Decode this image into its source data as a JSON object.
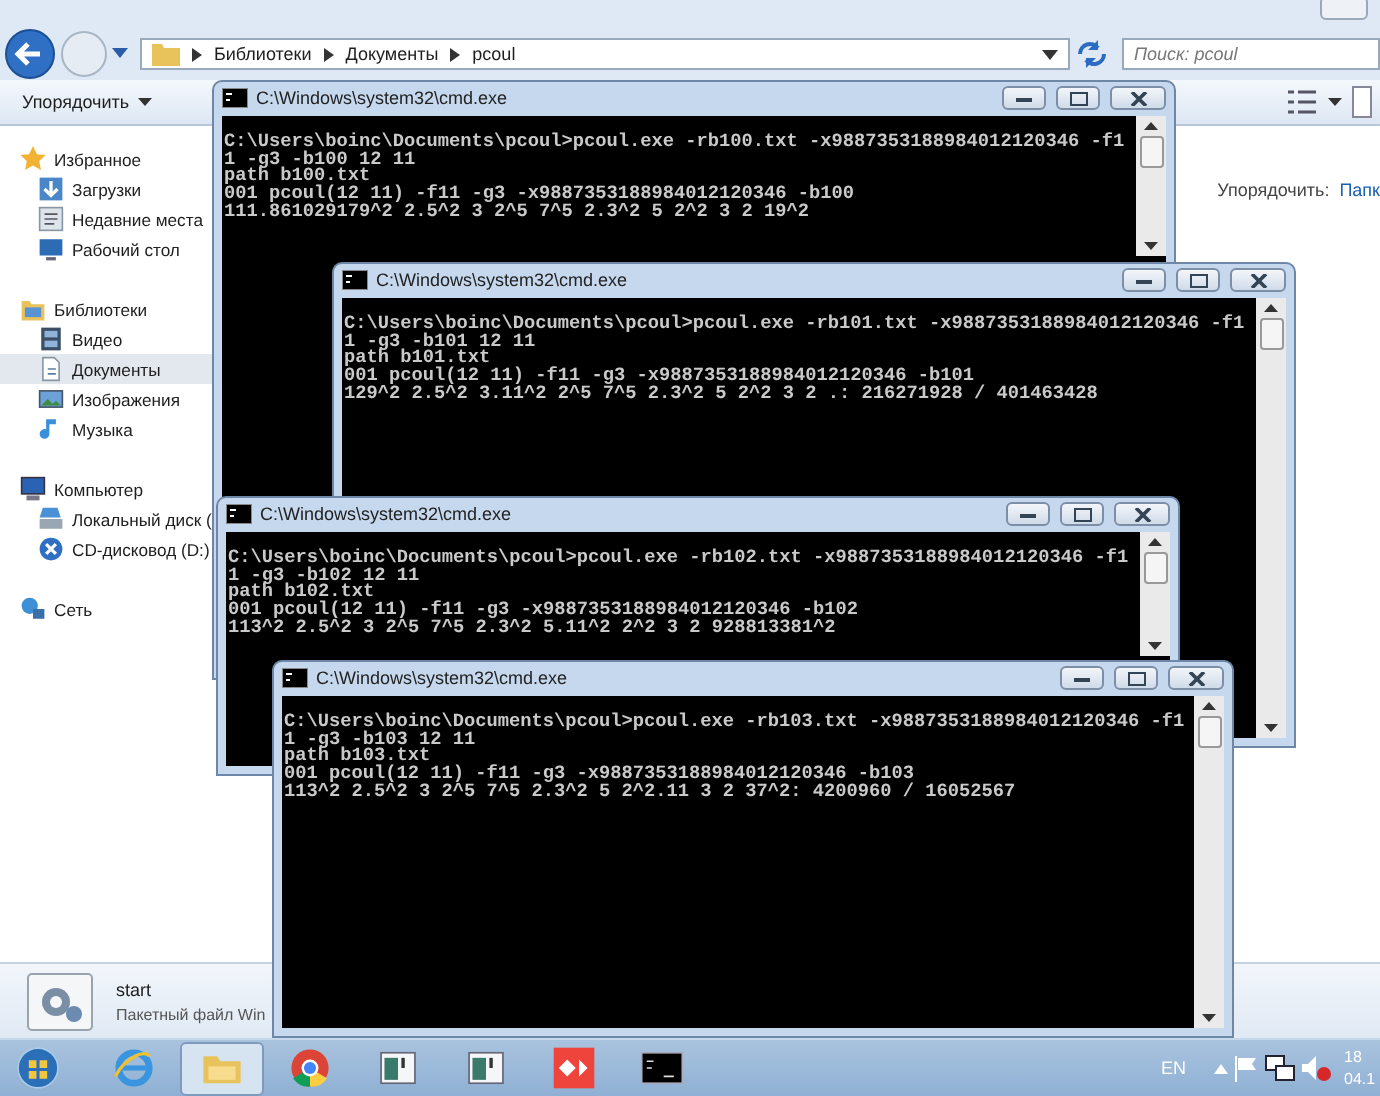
{
  "explorer": {
    "breadcrumb": [
      "Библиотеки",
      "Документы",
      "pcoul"
    ],
    "search": {
      "placeholder": "Поиск: pcoul"
    },
    "toolbar": {
      "organize": "Упорядочить"
    },
    "content_header": {
      "label": "Упорядочить:",
      "link": "Папк"
    },
    "sidebar": [
      {
        "label": "Избранное",
        "kind": "favorites",
        "children": [
          {
            "label": "Загрузки",
            "kind": "downloads",
            "selected": false
          },
          {
            "label": "Недавние места",
            "kind": "recent",
            "selected": false
          },
          {
            "label": "Рабочий стол",
            "kind": "desktop",
            "selected": false
          }
        ]
      },
      {
        "label": "Библиотеки",
        "kind": "libraries",
        "children": [
          {
            "label": "Видео",
            "kind": "video",
            "selected": false
          },
          {
            "label": "Документы",
            "kind": "documents",
            "selected": true
          },
          {
            "label": "Изображения",
            "kind": "pictures",
            "selected": false
          },
          {
            "label": "Музыка",
            "kind": "music",
            "selected": false
          }
        ]
      },
      {
        "label": "Компьютер",
        "kind": "computer",
        "children": [
          {
            "label": "Локальный диск (",
            "kind": "disk",
            "selected": false
          },
          {
            "label": "CD-дисковод (D:)",
            "kind": "cd",
            "selected": false
          }
        ]
      },
      {
        "label": "Сеть",
        "kind": "network"
      }
    ],
    "details": {
      "name": "start",
      "type": "Пакетный файл Win"
    }
  },
  "consoles": [
    {
      "title": "C:\\Windows\\system32\\cmd.exe",
      "lines": [
        "C:\\Users\\boinc\\Documents\\pcoul>pcoul.exe -rb100.txt -x9887353188984012120346 -f1",
        "1 -g3 -b100 12 11",
        "path b100.txt",
        "001 pcoul(12 11) -f11 -g3 -x9887353188984012120346 -b100",
        "111.861029179^2 2.5^2 3 2^5 7^5 2.3^2 5 2^2 3 2 19^2"
      ]
    },
    {
      "title": "C:\\Windows\\system32\\cmd.exe",
      "lines": [
        "C:\\Users\\boinc\\Documents\\pcoul>pcoul.exe -rb101.txt -x9887353188984012120346 -f1",
        "1 -g3 -b101 12 11",
        "path b101.txt",
        "001 pcoul(12 11) -f11 -g3 -x9887353188984012120346 -b101",
        "129^2 2.5^2 3.11^2 2^5 7^5 2.3^2 5 2^2 3 2 .: 216271928 / 401463428"
      ]
    },
    {
      "title": "C:\\Windows\\system32\\cmd.exe",
      "lines": [
        "C:\\Users\\boinc\\Documents\\pcoul>pcoul.exe -rb102.txt -x9887353188984012120346 -f1",
        "1 -g3 -b102 12 11",
        "path b102.txt",
        "001 pcoul(12 11) -f11 -g3 -x9887353188984012120346 -b102",
        "113^2 2.5^2 3 2^5 7^5 2.3^2 5.11^2 2^2 3 2 928813381^2"
      ]
    },
    {
      "title": "C:\\Windows\\system32\\cmd.exe",
      "lines": [
        "C:\\Users\\boinc\\Documents\\pcoul>pcoul.exe -rb103.txt -x9887353188984012120346 -f1",
        "1 -g3 -b103 12 11",
        "path b103.txt",
        "001 pcoul(12 11) -f11 -g3 -x9887353188984012120346 -b103",
        "113^2 2.5^2 3 2^5 7^5 2.3^2 5 2^2.11 3 2 37^2: 4200960 / 16052567"
      ]
    }
  ],
  "taskbar": {
    "items": [
      {
        "kind": "ie",
        "selected": false
      },
      {
        "kind": "explorer",
        "selected": true
      },
      {
        "kind": "chrome",
        "selected": false
      },
      {
        "kind": "window",
        "selected": false
      },
      {
        "kind": "window",
        "selected": false
      },
      {
        "kind": "remote",
        "selected": false
      },
      {
        "kind": "cmd",
        "selected": false
      }
    ],
    "language": "EN",
    "clock": [
      "18",
      "04.1"
    ]
  }
}
